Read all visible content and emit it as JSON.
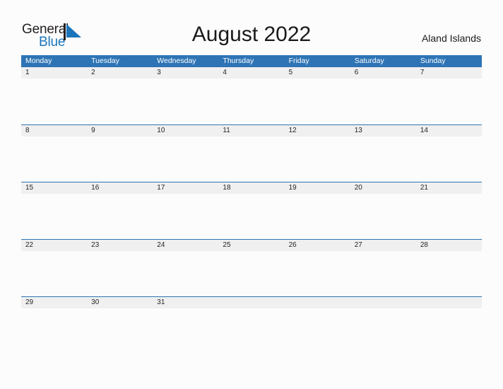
{
  "brand": {
    "name_part1": "General",
    "name_part2": "Blue",
    "mark_icon": "blue-triangle-flag-icon",
    "color_dark": "#231f20",
    "color_blue": "#1b75bb"
  },
  "header": {
    "title": "August 2022",
    "region": "Aland Islands"
  },
  "calendar": {
    "header_bg": "#2e74b5",
    "date_band_bg": "#f0f0f0",
    "grid_line_color": "#2e74b5",
    "weekdays": [
      "Monday",
      "Tuesday",
      "Wednesday",
      "Thursday",
      "Friday",
      "Saturday",
      "Sunday"
    ],
    "weeks": [
      {
        "dates": [
          "1",
          "2",
          "3",
          "4",
          "5",
          "6",
          "7"
        ]
      },
      {
        "dates": [
          "8",
          "9",
          "10",
          "11",
          "12",
          "13",
          "14"
        ]
      },
      {
        "dates": [
          "15",
          "16",
          "17",
          "18",
          "19",
          "20",
          "21"
        ]
      },
      {
        "dates": [
          "22",
          "23",
          "24",
          "25",
          "26",
          "27",
          "28"
        ]
      },
      {
        "dates": [
          "29",
          "30",
          "31",
          "",
          "",
          "",
          ""
        ]
      }
    ]
  }
}
